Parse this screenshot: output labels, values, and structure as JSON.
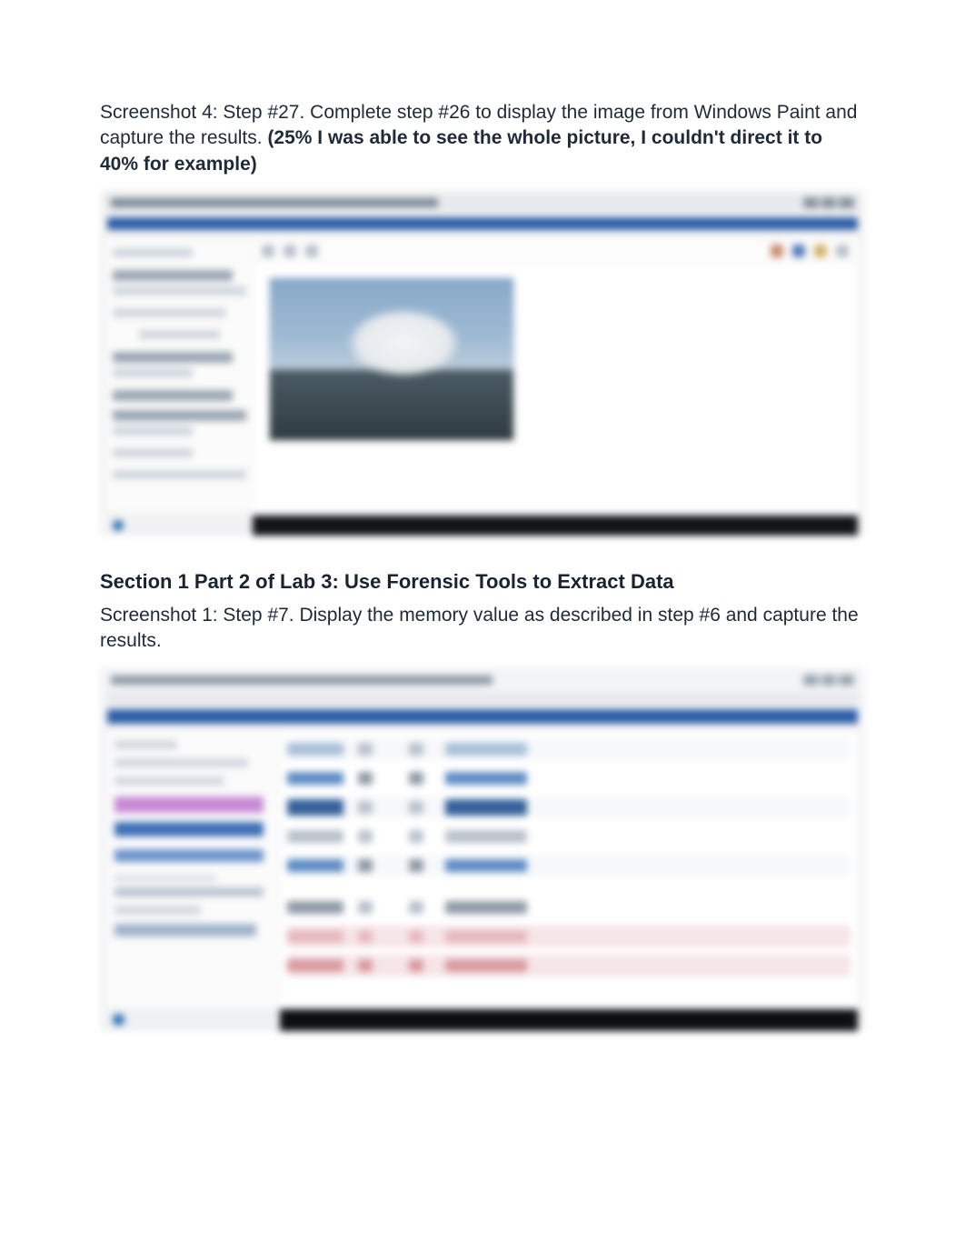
{
  "block1": {
    "caption_plain": "Screenshot 4: Step #27. Complete step #26 to display the image from Windows Paint and capture the results. ",
    "caption_bold": "(25% I was able to see the whole picture, I couldn't direct it to 40% for example)"
  },
  "block2": {
    "heading": "Section 1 Part 2 of Lab 3: Use Forensic Tools to Extract Data",
    "caption": "Screenshot 1: Step #7. Display the memory value as described in step #6 and capture the results."
  }
}
